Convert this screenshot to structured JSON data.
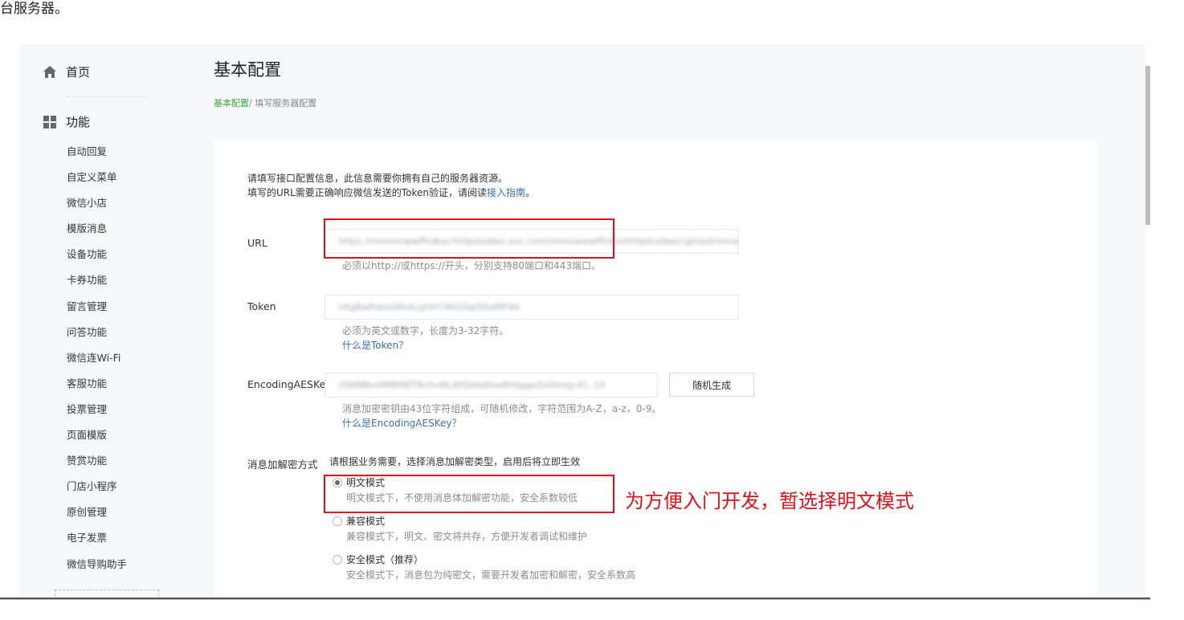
{
  "top_fragment": "台服务器。",
  "sidebar": {
    "home_label": "首页",
    "group_label": "功能",
    "items": [
      {
        "label": "自动回复"
      },
      {
        "label": "自定义菜单"
      },
      {
        "label": "微信小店"
      },
      {
        "label": "模版消息"
      },
      {
        "label": "设备功能"
      },
      {
        "label": "卡券功能"
      },
      {
        "label": "留言管理"
      },
      {
        "label": "问答功能"
      },
      {
        "label": "微信连Wi-Fi"
      },
      {
        "label": "客服功能"
      },
      {
        "label": "投票管理"
      },
      {
        "label": "页面模版"
      },
      {
        "label": "赞赏功能"
      },
      {
        "label": "门店小程序"
      },
      {
        "label": "原创管理"
      },
      {
        "label": "电子发票"
      },
      {
        "label": "微信导购助手"
      }
    ]
  },
  "header": {
    "title": "基本配置",
    "breadcrumb_link": "基本配置",
    "breadcrumb_current": "/ 填写服务器配置"
  },
  "form": {
    "intro_line1": "请填写接口配置信息，此信息需要你拥有自己的服务器资源。",
    "intro_line2_prefix": "填写的URL需要正确响应微信发送的Token验证，请阅读",
    "intro_link": "接入指南",
    "intro_line2_suffix": "。",
    "url": {
      "label": "URL",
      "value": "https://mmmmwwffhdkacrhfdpiksdwe.xxx.com/mmmwwwffhdkxrhfdpiksdwe/cgiload/mmw",
      "hint": "必须以http://或https://开头，分别支持80端口和443端口。"
    },
    "token": {
      "label": "Token",
      "value": "nKgBwfhwxQ6hXcgrVrCWkDSpQ5wMF9d",
      "hint": "必须为英文或数字，长度为3-32字符。",
      "link": "什么是Token？"
    },
    "aeskey": {
      "label": "EncodingAESKey",
      "value": "zXKBBkvHMBNBTfKchvNLdHQdddhxdfHdggeZsGhmg-41.-14",
      "button": "随机生成",
      "hint": "消息加密密钥由43位字符组成，可随机修改，字符范围为A-Z，a-z，0-9。",
      "link": "什么是EncodingAESKey？"
    },
    "mode": {
      "label": "消息加解密方式",
      "desc": "请根据业务需要，选择消息加解密类型，启用后将立即生效",
      "options": [
        {
          "label": "明文模式",
          "hint": "明文模式下，不使用消息体加解密功能，安全系数较低",
          "selected": true
        },
        {
          "label": "兼容模式",
          "hint": "兼容模式下，明文、密文将共存，方便开发者调试和维护",
          "selected": false
        },
        {
          "label": "安全模式（推荐）",
          "hint": "安全模式下，消息包为纯密文，需要开发者加密和解密，安全系数高",
          "selected": false
        }
      ]
    }
  },
  "annotation": "为方便入门开发，暂选择明文模式",
  "colors": {
    "accent_green": "#3baa3b",
    "link_blue": "#3d6fb0",
    "annotation_red": "#e0101a"
  },
  "icons": {
    "home": "home-icon",
    "features": "grid-icon"
  }
}
